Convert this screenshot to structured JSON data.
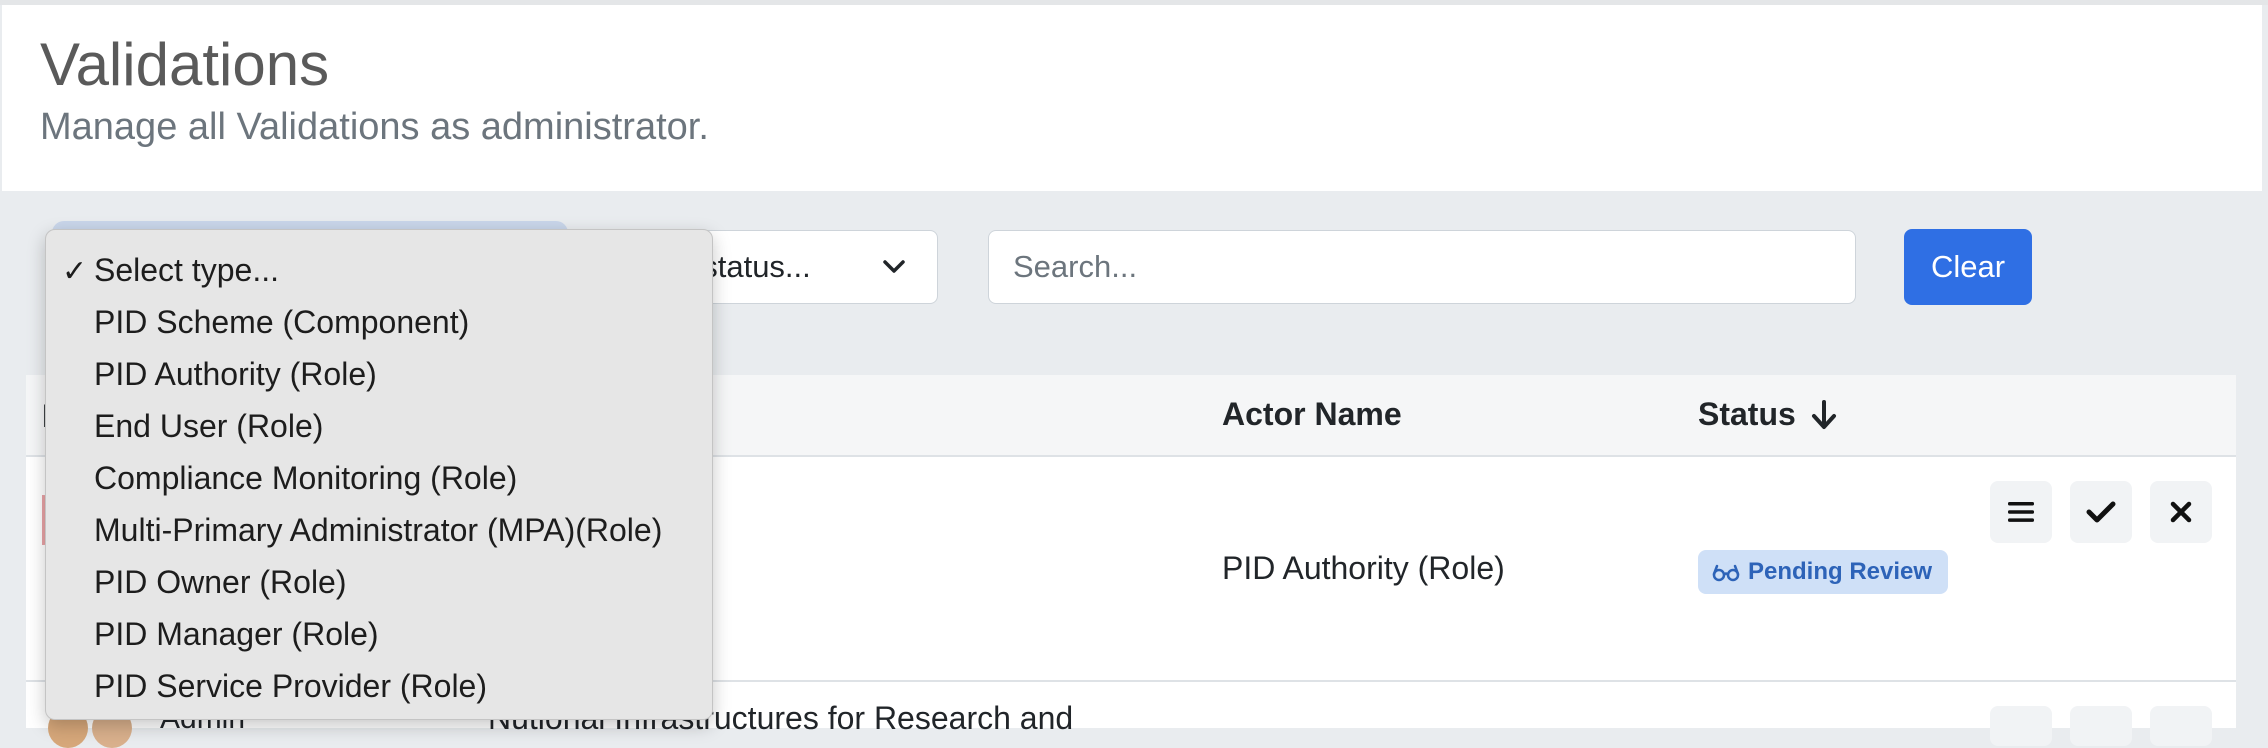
{
  "header": {
    "title": "Validations",
    "subtitle": "Manage all Validations as administrator."
  },
  "filters": {
    "type_select": {
      "selected": "Select type...",
      "options": [
        "Select type...",
        "PID Scheme (Component)",
        "PID Authority (Role)",
        "End User (Role)",
        "Compliance Monitoring (Role)",
        "Multi-Primary Administrator (MPA)(Role)",
        "PID Owner (Role)",
        "PID Manager (Role)",
        "PID Service Provider (Role)"
      ]
    },
    "status_select": {
      "visible_text": "t status..."
    },
    "search": {
      "placeholder": "Search..."
    },
    "clear_label": "Clear"
  },
  "table": {
    "columns": {
      "first_partial": "I",
      "actor_name": "Actor Name",
      "status": "Status"
    },
    "rows": [
      {
        "actor_name": "PID Authority (Role)",
        "status": "Pending Review"
      },
      {
        "name_partial": "Admin",
        "text_partial": "Nutional Infrastructures for Research and"
      }
    ]
  },
  "colors": {
    "accent": "#2f6fe4",
    "badge_bg": "#cfe0f7",
    "badge_text": "#2d63b8"
  },
  "icons": [
    "chevron-down-icon",
    "sort-arrow-down-icon",
    "glasses-icon",
    "list-icon",
    "check-icon",
    "close-icon",
    "checkmark-icon"
  ]
}
